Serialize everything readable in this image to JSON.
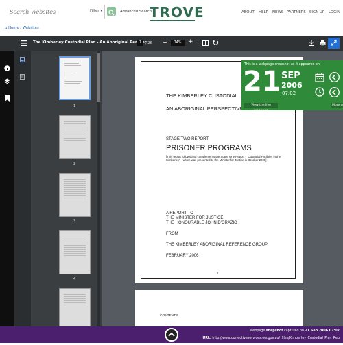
{
  "header": {
    "search_placeholder": "Search Websites",
    "filter_label": "Filter ▾",
    "advanced_search": "Advanced Search",
    "logo_text": "TROVE",
    "nav": [
      "ABOUT",
      "HELP",
      "NEWS",
      "PARTNERS",
      "SIGN UP",
      "LOGIN"
    ]
  },
  "breadcrumb": {
    "home": "Home",
    "sep": "/",
    "current": "Websites"
  },
  "toolbar": {
    "title": "The Kimberley Custodial Plan - An Aboriginal Perspec...",
    "page": "1",
    "total": "/ 26",
    "zoom": "74%"
  },
  "thumbnails": [
    "1",
    "2",
    "3",
    "4"
  ],
  "document": {
    "title_line1": "THE KIMBERLEY CUSTODIAL",
    "title_line2": "AN ABORIGINAL PERSPECTIVE",
    "stage": "STAGE TWO REPORT",
    "program": "PRISONER PROGRAMS",
    "note": "[This report follows and complements the Stage One Report - \"Custodial Facilities in the Kimberley\" - which was presented to the Minister for Justice in October 2005]",
    "report_to_1": "A REPORT TO",
    "report_to_2": "THE MINISTER FOR JUSTICE,",
    "report_to_3": "THE HONOURABLE JOHN D'ORAZIO",
    "from": "FROM",
    "group": "THE KIMBERLEY ABORIGINAL REFERENCE GROUP",
    "date": "FEBRUARY 2006",
    "page_number": "1",
    "page2_heading": "CONTENTS"
  },
  "snapshot": {
    "label": "This is a webpage snapshot as it appeared on",
    "day": "21",
    "month": "SEP",
    "year": "2006",
    "time": "07:02",
    "live_button": "View the live webpage",
    "more_button": "More co"
  },
  "footer": {
    "line1_prefix": "Webpage ",
    "line1_bold": "snapshot",
    "line1_mid": " captured on ",
    "line1_date": "21 Sep 2006 07:02",
    "line2_label": "URL:",
    "line2_url": " http://www.correctiveservices.wa.gov.au/_files/Kimberley_Custodial_Plan_Rep"
  },
  "colors": {
    "trove_green": "#2f6b4f",
    "snapshot_green": "#2f8b3a",
    "footer_purple": "#4b1f6e",
    "toolbar_dark": "#2f3336"
  }
}
